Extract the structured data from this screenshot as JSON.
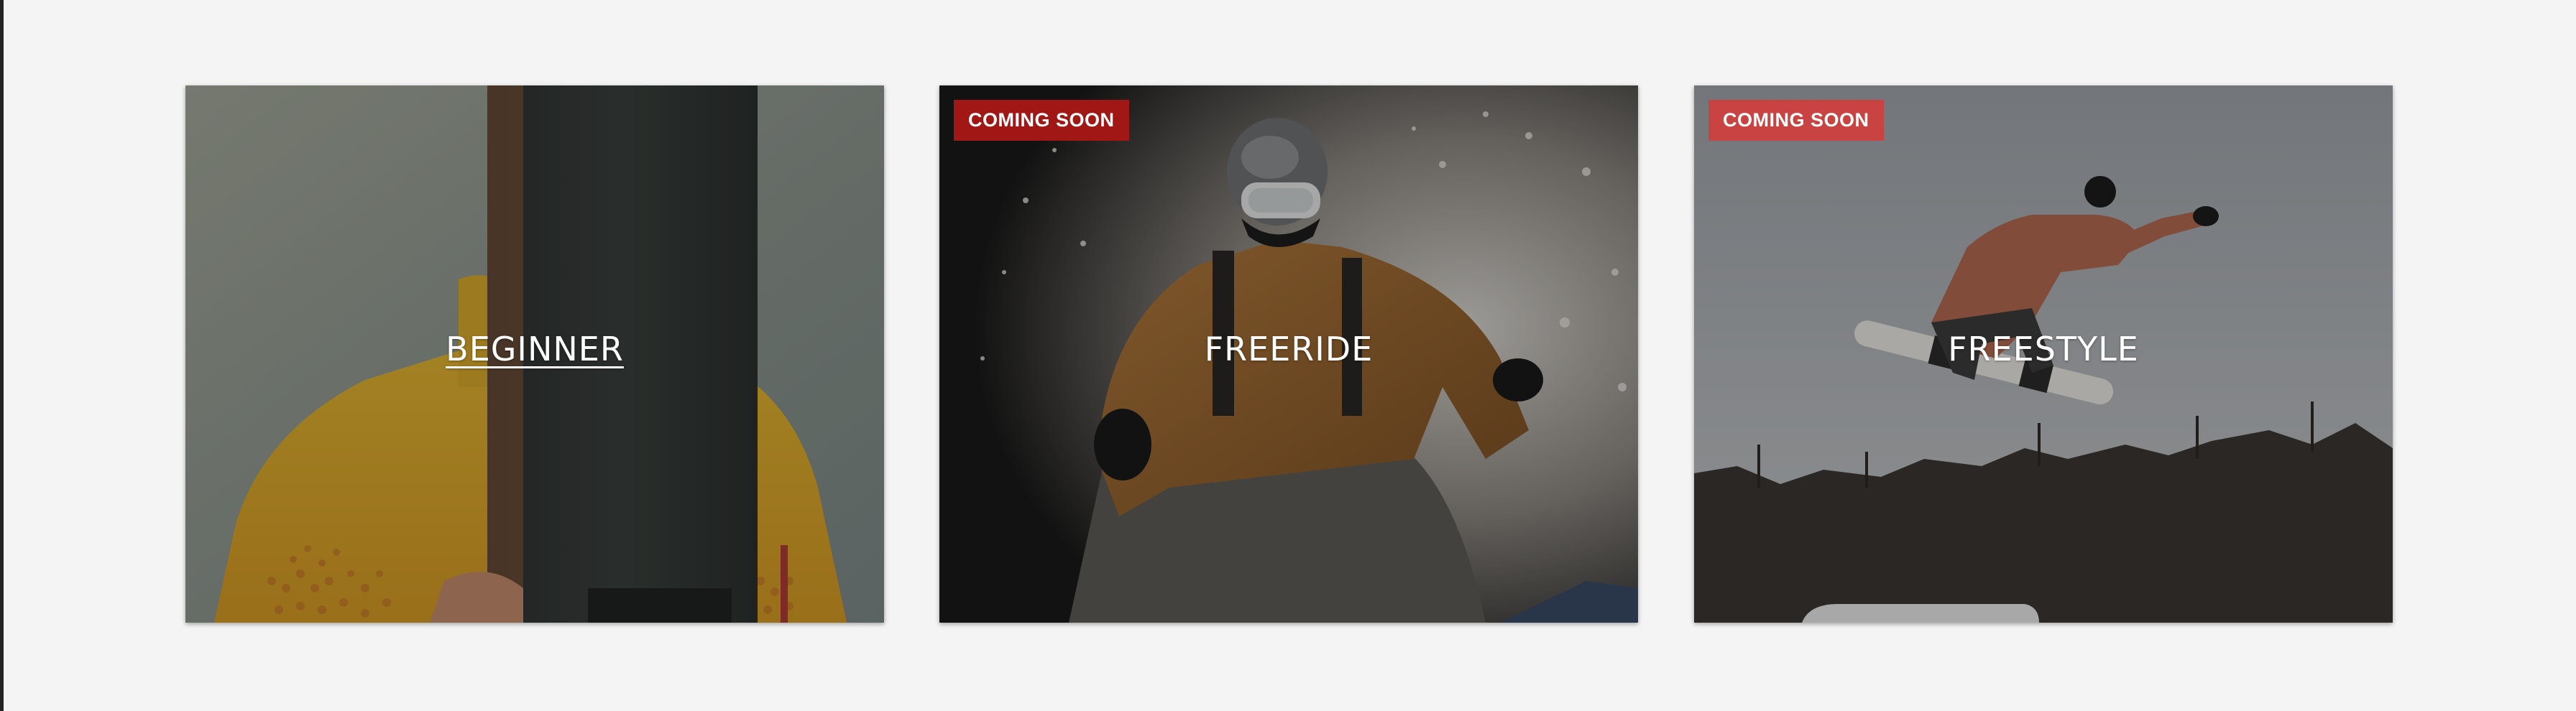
{
  "cards": [
    {
      "title": "BEGINNER",
      "badge": "",
      "image": "person-holding-snowboard-photo"
    },
    {
      "title": "FREERIDE",
      "badge": "COMING SOON",
      "image": "snowboarder-in-powder-spray-photo"
    },
    {
      "title": "FREESTYLE",
      "badge": "COMING SOON",
      "image": "snowboarder-mid-air-jump-photo"
    }
  ],
  "colors": {
    "background": "#f4f4f4",
    "badge_dark": "#a01715",
    "badge_light": "#c84341",
    "title_text": "#ffffff"
  }
}
